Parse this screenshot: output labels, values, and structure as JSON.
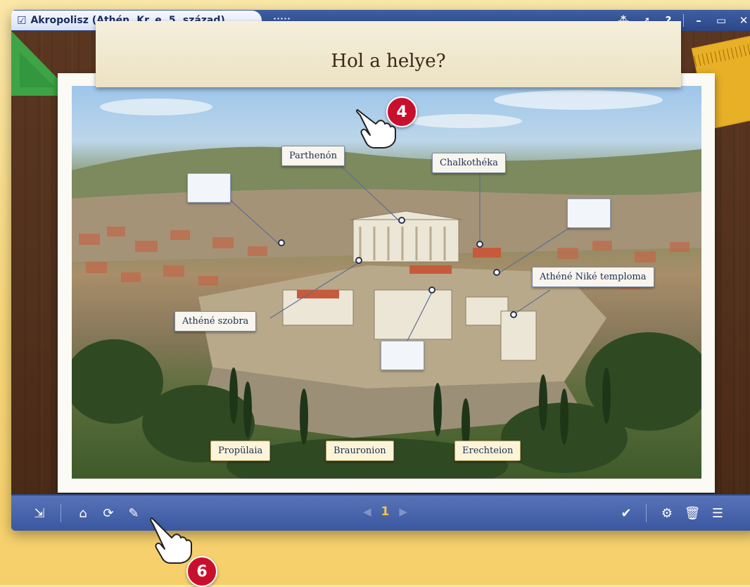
{
  "window": {
    "title": "Akropolisz (Athén, Kr. e. 5. század)",
    "controls": [
      "share-icon",
      "pointer-icon",
      "help-icon",
      "minimize-icon",
      "maximize-icon",
      "close-icon"
    ]
  },
  "page": {
    "title": "Hol a helye?"
  },
  "placed_labels": [
    "Parthenón",
    "Chalkothéka",
    "Athéné Niké temploma",
    "Athéné szobra"
  ],
  "label_bank": [
    "Propülaia",
    "Brauronion",
    "Erechteion"
  ],
  "empty_targets": 3,
  "toolbar": {
    "left_buttons": [
      "export-icon",
      "home-icon",
      "reload-icon",
      "edit-icon"
    ],
    "page_number": "1",
    "right_buttons": [
      "check-icon",
      "settings-icon",
      "trash-icon",
      "notes-icon"
    ]
  },
  "callouts": {
    "step_top": "4",
    "step_bottom": "6"
  },
  "colors": {
    "toolbar": "#3a57a0",
    "badge": "#c8102e",
    "accent_page": "#f4c64a"
  }
}
